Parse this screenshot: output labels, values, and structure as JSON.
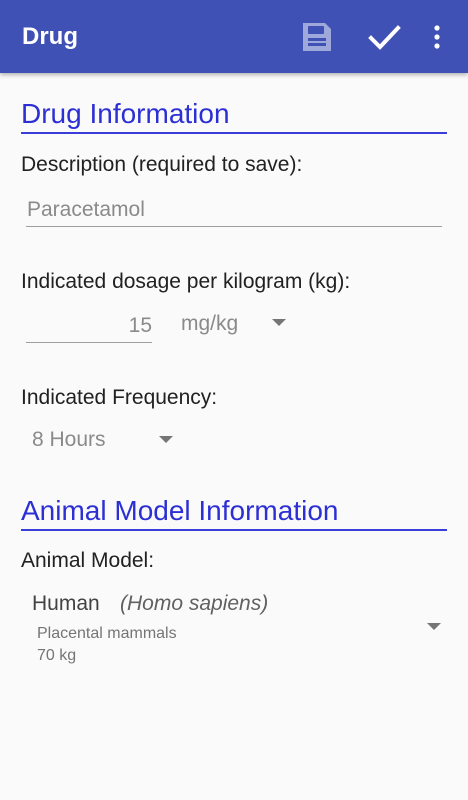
{
  "appbar": {
    "title": "Drug",
    "actions": [
      "save-icon",
      "check-icon",
      "more-vert-icon"
    ],
    "color": "#3f51b5"
  },
  "drug_info": {
    "header": "Drug Information",
    "description_label": "Description (required to save):",
    "description_value": "Paracetamol",
    "dosage_label": "Indicated dosage per kilogram (kg):",
    "dosage_value": "15",
    "dosage_unit": "mg/kg",
    "frequency_label": "Indicated Frequency:",
    "frequency_value": "8 Hours"
  },
  "animal_info": {
    "header": "Animal Model Information",
    "model_label": "Animal Model:",
    "model_name": "Human",
    "model_scientific": "(Homo sapiens)",
    "model_class": "Placental mammals",
    "model_weight": "70 kg"
  },
  "accent_color": "#2c2fd4"
}
